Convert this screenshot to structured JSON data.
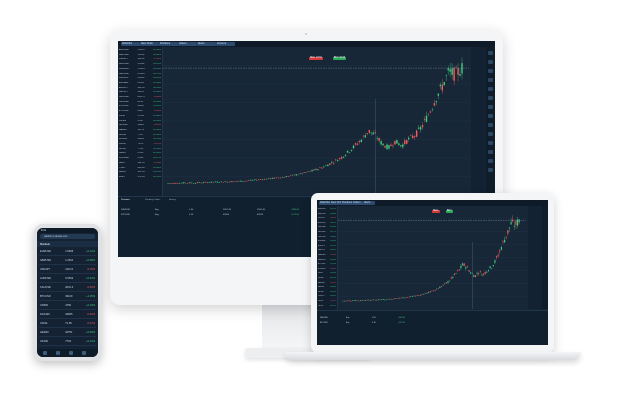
{
  "desktop": {
    "toolbar": {
      "buttons": [
        "Watchlist",
        "New Order",
        "Positions",
        "Orders",
        "Alerts",
        "Account"
      ]
    },
    "watchlist": {
      "rows": [
        {
          "symbol": "EURUSD",
          "price": "1.0845",
          "change": "+0.12%",
          "dir": "up"
        },
        {
          "symbol": "GBPUSD",
          "price": "1.2631",
          "change": "+0.08%",
          "dir": "up"
        },
        {
          "symbol": "USDJPY",
          "price": "149.21",
          "change": "-0.15%",
          "dir": "dn"
        },
        {
          "symbol": "AUDUSD",
          "price": "0.6542",
          "change": "+0.21%",
          "dir": "up"
        },
        {
          "symbol": "USDCAD",
          "price": "1.3594",
          "change": "+0.05%",
          "dir": "up"
        },
        {
          "symbol": "NZDUSD",
          "price": "0.6103",
          "change": "+0.17%",
          "dir": "up"
        },
        {
          "symbol": "USDCHF",
          "price": "0.8812",
          "change": "+0.04%",
          "dir": "up"
        },
        {
          "symbol": "EURGBP",
          "price": "0.8587",
          "change": "+0.09%",
          "dir": "up"
        },
        {
          "symbol": "EURJPY",
          "price": "161.83",
          "change": "+0.11%",
          "dir": "up"
        },
        {
          "symbol": "GBPJPY",
          "price": "188.47",
          "change": "+0.02%",
          "dir": "up"
        },
        {
          "symbol": "XAUUSD",
          "price": "2031.4",
          "change": "-0.32%",
          "dir": "dn"
        },
        {
          "symbol": "XAGUSD",
          "price": "22.91",
          "change": "+0.44%",
          "dir": "up"
        },
        {
          "symbol": "BTCUSD",
          "price": "43120",
          "change": "+1.25%",
          "dir": "up"
        },
        {
          "symbol": "ETHUSD",
          "price": "2284",
          "change": "-0.41%",
          "dir": "dn"
        },
        {
          "symbol": "US30",
          "price": "37562",
          "change": "+0.18%",
          "dir": "up"
        },
        {
          "symbol": "US500",
          "price": "4769",
          "change": "+0.10%",
          "dir": "up"
        },
        {
          "symbol": "NAS100",
          "price": "16825",
          "change": "-0.22%",
          "dir": "dn"
        },
        {
          "symbol": "GER40",
          "price": "16751",
          "change": "+0.06%",
          "dir": "up"
        },
        {
          "symbol": "UK100",
          "price": "7733",
          "change": "+0.14%",
          "dir": "up"
        },
        {
          "symbol": "JPN225",
          "price": "33464",
          "change": "+0.31%",
          "dir": "up"
        },
        {
          "symbol": "USOIL",
          "price": "71.65",
          "change": "-0.27%",
          "dir": "dn"
        },
        {
          "symbol": "UKOIL",
          "price": "77.04",
          "change": "+0.12%",
          "dir": "up"
        },
        {
          "symbol": "NGAS",
          "price": "2.513",
          "change": "+0.36%",
          "dir": "up"
        },
        {
          "symbol": "COPPER",
          "price": "3.894",
          "change": "+0.07%",
          "dir": "up"
        },
        {
          "symbol": "AAPL",
          "price": "192.53",
          "change": "-0.19%",
          "dir": "dn"
        },
        {
          "symbol": "TSLA",
          "price": "248.48",
          "change": "+0.58%",
          "dir": "up"
        },
        {
          "symbol": "AMZN",
          "price": "151.94",
          "change": "+0.25%",
          "dir": "up"
        },
        {
          "symbol": "MSFT",
          "price": "376.04",
          "change": "+0.15%",
          "dir": "up"
        }
      ]
    },
    "trade_buttons": {
      "sell": "SELL 42.51",
      "buy": "BUY 42.53"
    },
    "bottom_tabs": [
      "Positions",
      "Pending Orders",
      "History"
    ],
    "bottom_rows": [
      [
        "XAUUSD",
        "Buy",
        "1.00",
        "2021.45",
        "2031.40",
        "+995.00"
      ],
      [
        "BTCUSD",
        "Buy",
        "0.10",
        "41850",
        "43120",
        "+127.00"
      ]
    ]
  },
  "laptop": {
    "toolbar": {
      "buttons": [
        "Watchlist",
        "New Order",
        "Positions",
        "Orders",
        "Alerts"
      ]
    },
    "trade_buttons": {
      "sell": "SELL",
      "buy": "BUY"
    },
    "bottom_rows": [
      [
        "XAUUSD",
        "Buy",
        "1.00",
        "+995.00"
      ],
      [
        "BTCUSD",
        "Buy",
        "0.10",
        "+127.00"
      ]
    ]
  },
  "phone": {
    "status": {
      "time": "9:41"
    },
    "url": "platform.example.com",
    "header": "Markets",
    "rows": [
      {
        "symbol": "EURUSD",
        "price": "1.0845",
        "change": "+0.12%",
        "dir": "up"
      },
      {
        "symbol": "GBPUSD",
        "price": "1.2631",
        "change": "+0.08%",
        "dir": "up"
      },
      {
        "symbol": "USDJPY",
        "price": "149.21",
        "change": "-0.15%",
        "dir": "dn"
      },
      {
        "symbol": "AUDUSD",
        "price": "0.6542",
        "change": "+0.21%",
        "dir": "up"
      },
      {
        "symbol": "XAUUSD",
        "price": "2031.4",
        "change": "-0.32%",
        "dir": "dn"
      },
      {
        "symbol": "BTCUSD",
        "price": "43120",
        "change": "+1.25%",
        "dir": "up"
      },
      {
        "symbol": "US500",
        "price": "4769",
        "change": "+0.10%",
        "dir": "up"
      },
      {
        "symbol": "NAS100",
        "price": "16825",
        "change": "-0.22%",
        "dir": "dn"
      },
      {
        "symbol": "USOIL",
        "price": "71.65",
        "change": "-0.27%",
        "dir": "dn"
      },
      {
        "symbol": "GER40",
        "price": "16751",
        "change": "+0.06%",
        "dir": "up"
      },
      {
        "symbol": "UK100",
        "price": "7733",
        "change": "+0.14%",
        "dir": "up"
      }
    ]
  },
  "colors": {
    "up": "#3fd17f",
    "down": "#ff5c5c",
    "panel": "#162536",
    "accent": "#2d4b6e"
  },
  "chart_data": {
    "type": "line",
    "title": "",
    "xlabel": "",
    "ylabel": "",
    "series": [
      {
        "values": [
          2,
          2.1,
          2.2,
          2.3,
          2.2,
          2.4,
          2.5,
          2.6,
          2.7,
          2.8,
          2.9,
          3.1,
          3.3,
          3.6,
          3.9,
          4.2,
          4.5,
          4.9,
          5.4,
          6.0,
          6.6,
          7.4,
          8.4,
          9.5,
          11,
          12.6,
          14.5,
          17,
          20,
          23,
          27,
          25,
          21,
          19,
          22,
          20,
          23,
          25,
          29,
          35,
          42,
          48,
          55,
          54,
          57
        ]
      }
    ]
  }
}
